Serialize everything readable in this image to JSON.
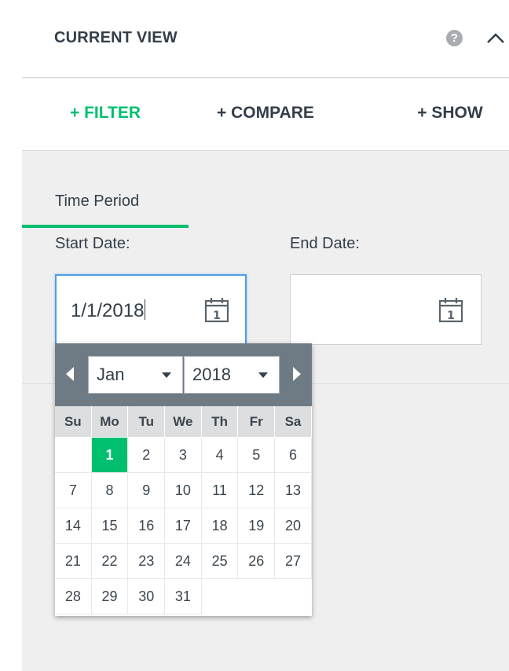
{
  "header": {
    "title": "CURRENT VIEW",
    "help_icon": "question-icon",
    "collapse_icon": "chevron-up-icon"
  },
  "tabs": [
    {
      "label": "+ FILTER",
      "active": true
    },
    {
      "label": "+ COMPARE",
      "active": false
    },
    {
      "label": "+ SHOW",
      "active": false
    }
  ],
  "filter": {
    "section_label": "Time Period",
    "start_label": "Start Date:",
    "end_label": "End Date:",
    "start_value": "1/1/2018",
    "end_value": ""
  },
  "datepicker": {
    "month": "Jan",
    "year": "2018",
    "weekdays": [
      "Su",
      "Mo",
      "Tu",
      "We",
      "Th",
      "Fr",
      "Sa"
    ],
    "weeks": [
      [
        "",
        "1",
        "2",
        "3",
        "4",
        "5",
        "6"
      ],
      [
        "7",
        "8",
        "9",
        "10",
        "11",
        "12",
        "13"
      ],
      [
        "14",
        "15",
        "16",
        "17",
        "18",
        "19",
        "20"
      ],
      [
        "21",
        "22",
        "23",
        "24",
        "25",
        "26",
        "27"
      ],
      [
        "28",
        "29",
        "30",
        "31",
        "",
        "",
        ""
      ]
    ],
    "selected_day": "1"
  },
  "colors": {
    "accent": "#00bf6f",
    "focus_border": "#4e9ee6",
    "picker_header": "#6f7b84"
  }
}
